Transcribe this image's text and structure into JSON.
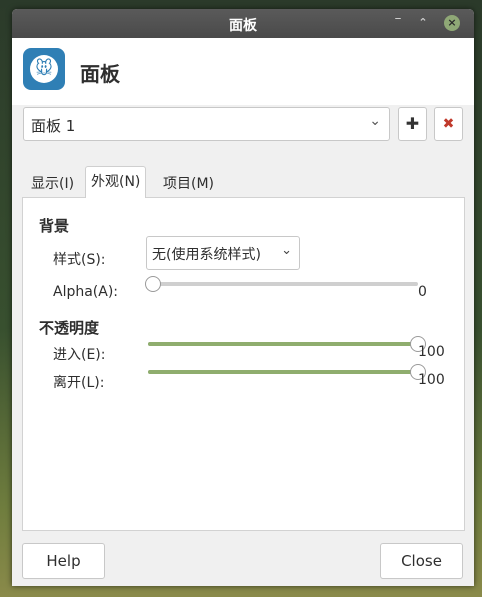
{
  "window": {
    "title": "面板"
  },
  "window_controls": {
    "minimize": "‾",
    "maximize": "⌃",
    "close": "×"
  },
  "header": {
    "title": "面板",
    "icon": "panel-app-icon"
  },
  "panel_selector": {
    "value": "面板 1",
    "add_icon": "plus-icon",
    "remove_icon": "close-icon"
  },
  "tabs": [
    {
      "label": "显示(I)",
      "active": false
    },
    {
      "label": "外观(N)",
      "active": true
    },
    {
      "label": "项目(M)",
      "active": false
    }
  ],
  "background": {
    "heading": "背景",
    "style_label": "样式(S):",
    "style_value": "无(使用系统样式)",
    "alpha_label": "Alpha(A):",
    "alpha_value": "0",
    "alpha_fraction": 0
  },
  "opacity": {
    "heading": "不透明度",
    "enter_label": "进入(E):",
    "enter_value": "100",
    "enter_fraction": 1,
    "leave_label": "离开(L):",
    "leave_value": "100",
    "leave_fraction": 1
  },
  "footer": {
    "help_label": "Help",
    "close_label": "Close"
  },
  "colors": {
    "accent": "#8fad6e",
    "app_icon": "#2f7fb5",
    "delete": "#c0392b"
  }
}
